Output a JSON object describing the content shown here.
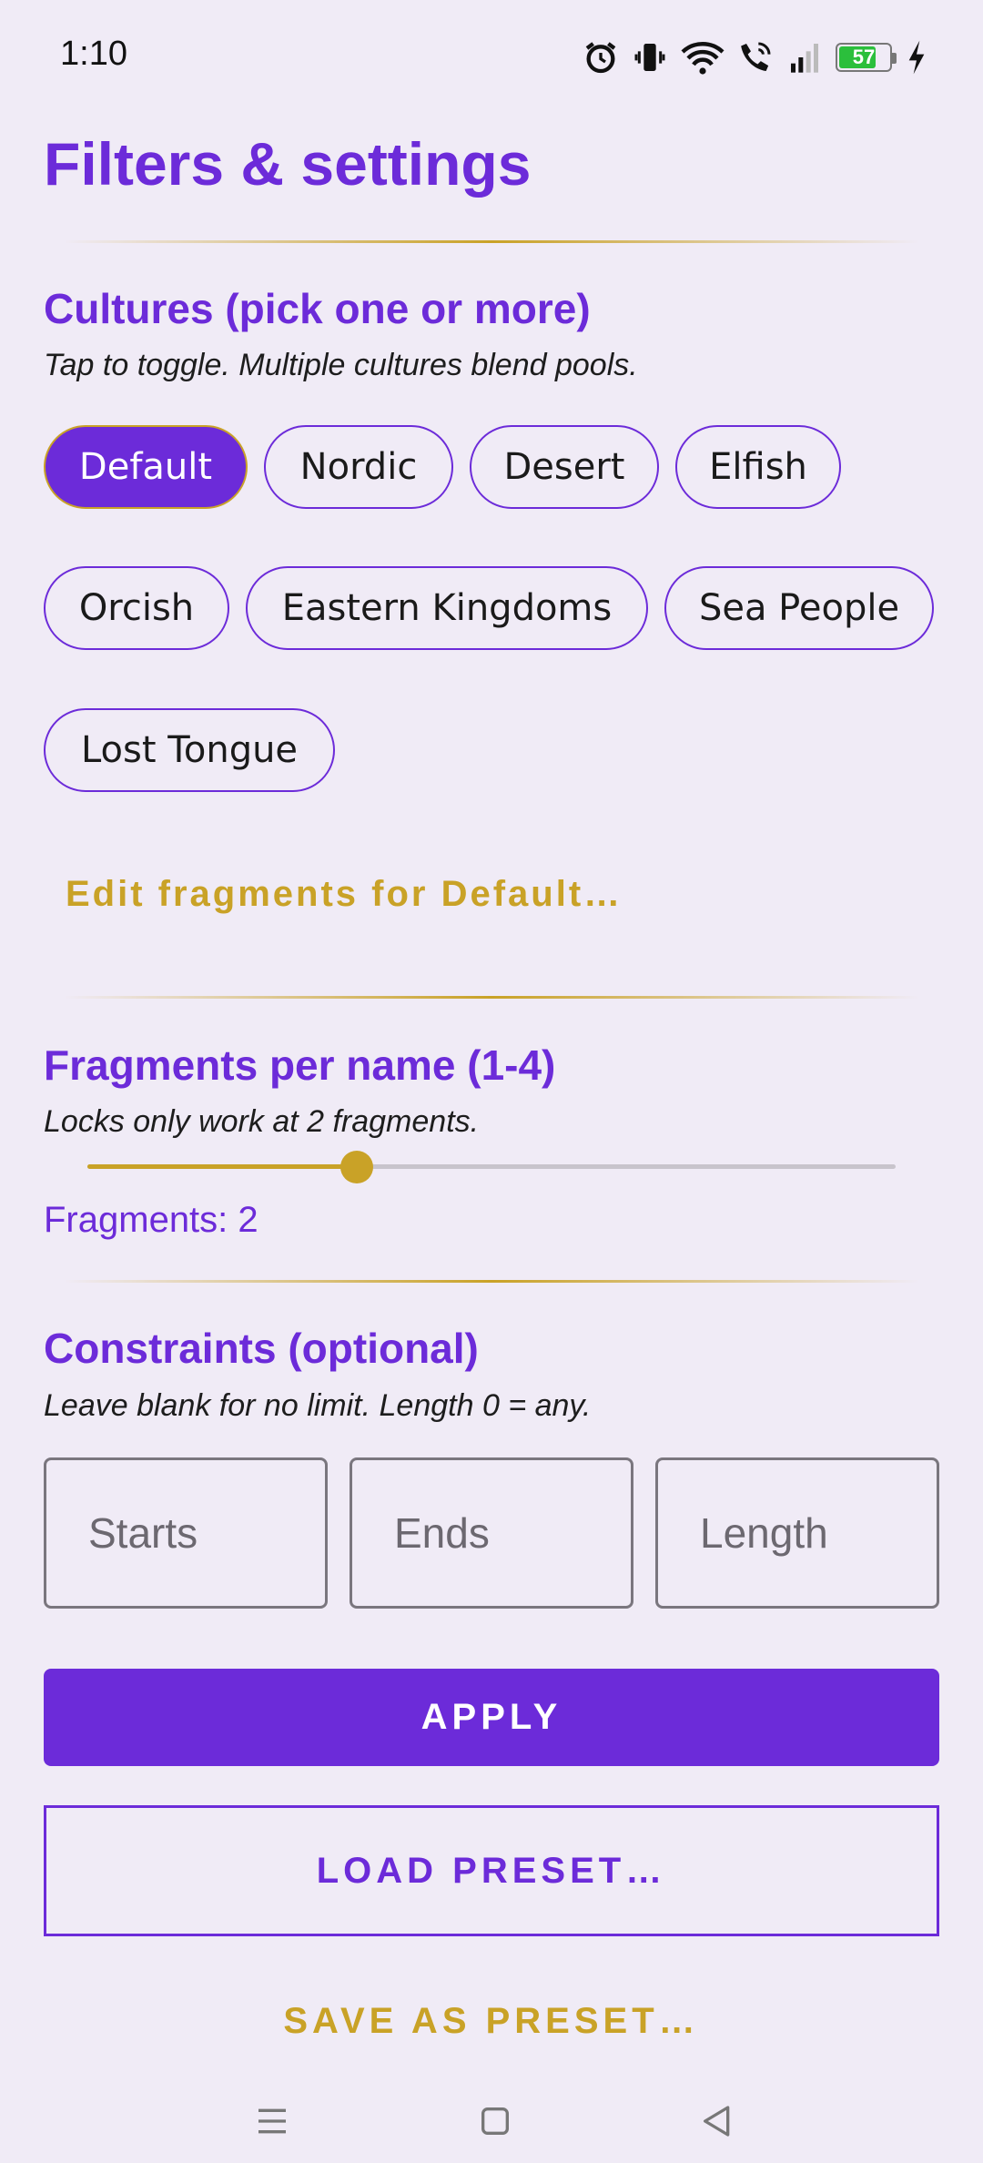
{
  "status_bar": {
    "time": "1:10",
    "battery": "57",
    "icons": [
      "alarm-icon",
      "vibrate-icon",
      "wifi-icon",
      "wifi-calling-icon",
      "signal-icon",
      "battery-icon",
      "charging-icon"
    ]
  },
  "page": {
    "title": "Filters & settings"
  },
  "cultures": {
    "title": "Cultures (pick one or more)",
    "subtitle": "Tap to toggle. Multiple cultures blend pools.",
    "chips": [
      {
        "label": "Default",
        "selected": true
      },
      {
        "label": "Nordic",
        "selected": false
      },
      {
        "label": "Desert",
        "selected": false
      },
      {
        "label": "Elfish",
        "selected": false
      },
      {
        "label": "Orcish",
        "selected": false
      },
      {
        "label": "Eastern Kingdoms",
        "selected": false
      },
      {
        "label": "Sea People",
        "selected": false
      },
      {
        "label": "Lost Tongue",
        "selected": false
      }
    ],
    "edit_link": "Edit fragments for Default…"
  },
  "fragments": {
    "title": "Fragments per name (1-4)",
    "subtitle": "Locks only work at 2 fragments.",
    "slider": {
      "min": 1,
      "max": 4,
      "value": 2
    },
    "readout": "Fragments: 2"
  },
  "constraints": {
    "title": "Constraints (optional)",
    "subtitle": "Leave blank for no limit. Length 0 = any.",
    "fields": [
      {
        "placeholder": "Starts",
        "value": ""
      },
      {
        "placeholder": "Ends",
        "value": ""
      },
      {
        "placeholder": "Length",
        "value": ""
      }
    ]
  },
  "actions": {
    "apply": "APPLY",
    "load_preset": "LOAD PRESET…",
    "save_preset": "SAVE AS PRESET…"
  },
  "colors": {
    "accent": "#6c2bd9",
    "gold": "#c9a227",
    "background": "#f0ebf6",
    "battery_green": "#2bbf3c"
  },
  "nav_bar": {
    "icons": [
      "menu-icon",
      "home-icon",
      "back-icon"
    ]
  }
}
